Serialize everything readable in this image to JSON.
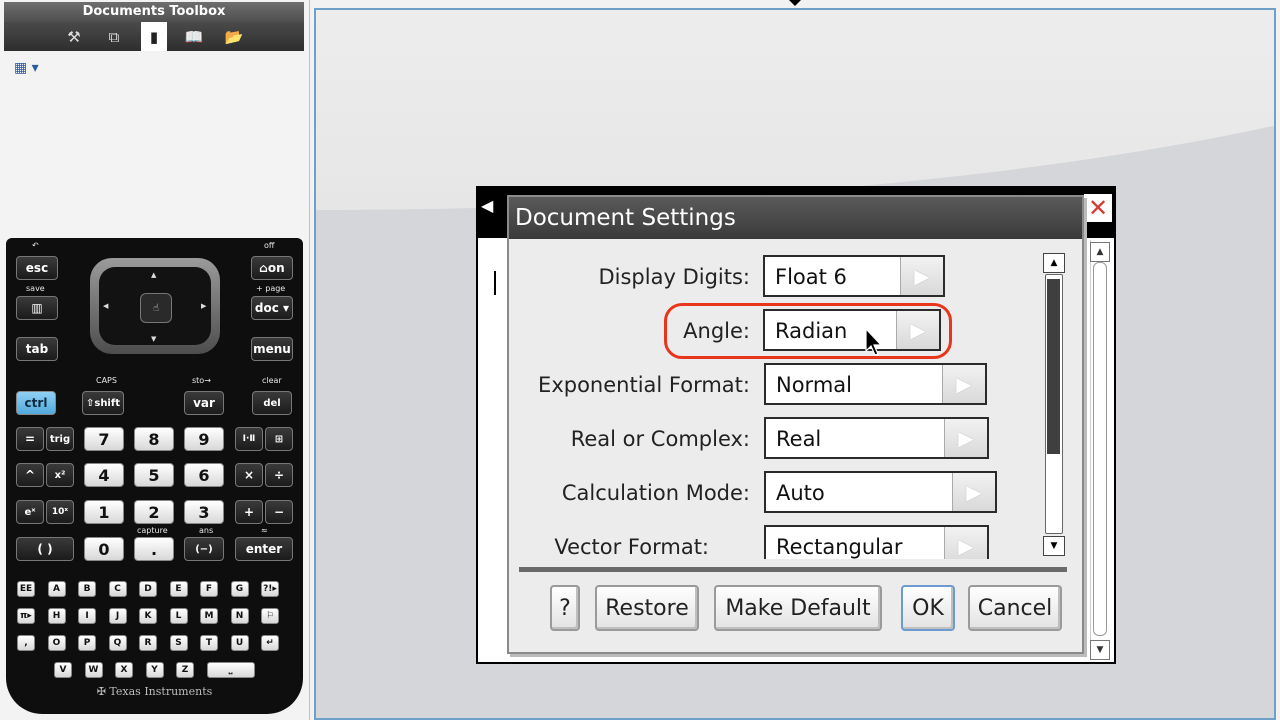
{
  "toolbox": {
    "title": "Documents Toolbox",
    "tabs": [
      {
        "name": "tools-icon",
        "glyph": "⚒"
      },
      {
        "name": "page-sorter-icon",
        "glyph": "⧉"
      },
      {
        "name": "handheld-icon",
        "glyph": "▮"
      },
      {
        "name": "utilities-icon",
        "glyph": "📖"
      },
      {
        "name": "content-explorer-icon",
        "glyph": "📂"
      }
    ],
    "doc_icon": "▦ ▾"
  },
  "calculator": {
    "labels": {
      "undo": "↶",
      "off": "off",
      "save": "save",
      "page": "+ page",
      "caps": "CAPS",
      "sto": "sto→",
      "clear": "clear",
      "capture": "capture",
      "ans": "ans",
      "approx": "≈",
      "logo": "✠ Texas Instruments"
    },
    "keys": {
      "esc": "esc",
      "on": "⌂on",
      "scratch": "▥",
      "doc": "doc ▾",
      "tab": "tab",
      "menu": "menu",
      "ctrl": "ctrl",
      "shift": "⇧shift",
      "var": "var",
      "del": "del",
      "eq": "=",
      "trig": "trig",
      "sep": "Ⅰ·Ⅱ",
      "book": "⊞",
      "caret": "^",
      "x2": "x²",
      "times": "×",
      "divide": "÷",
      "ex": "eˣ",
      "tenx": "10ˣ",
      "plus": "+",
      "minus": "−",
      "paren": "(   )",
      "neg": "(−)",
      "enter": "enter",
      "dot": ".",
      "n0": "0",
      "n1": "1",
      "n2": "2",
      "n3": "3",
      "n4": "4",
      "n5": "5",
      "n6": "6",
      "n7": "7",
      "n8": "8",
      "n9": "9"
    },
    "alpha_rows": [
      [
        "EE",
        "A",
        "B",
        "C",
        "D",
        "E",
        "F",
        "G",
        "?!▸"
      ],
      [
        "π▸",
        "H",
        "I",
        "J",
        "K",
        "L",
        "M",
        "N",
        "⚐"
      ],
      [
        ",",
        "O",
        "P",
        "Q",
        "R",
        "S",
        "T",
        "U",
        "↵"
      ],
      [
        "V",
        "W",
        "X",
        "Y",
        "Z",
        "⎵"
      ]
    ]
  },
  "handheld": {
    "dialog": {
      "title": "Document Settings",
      "settings": [
        {
          "label": "Display Digits:",
          "value": "Float 6"
        },
        {
          "label": "Angle:",
          "value": "Radian"
        },
        {
          "label": "Exponential Format:",
          "value": "Normal"
        },
        {
          "label": "Real or Complex:",
          "value": "Real"
        },
        {
          "label": "Calculation Mode:",
          "value": "Auto"
        },
        {
          "label": "Vector Format:",
          "value": "Rectangular"
        }
      ],
      "buttons": {
        "help": "?",
        "restore": "Restore",
        "make_default": "Make Default",
        "ok": "OK",
        "cancel": "Cancel"
      }
    },
    "close_glyph": "✕",
    "left_arrow": "◀",
    "arrow_glyph": "▶"
  }
}
